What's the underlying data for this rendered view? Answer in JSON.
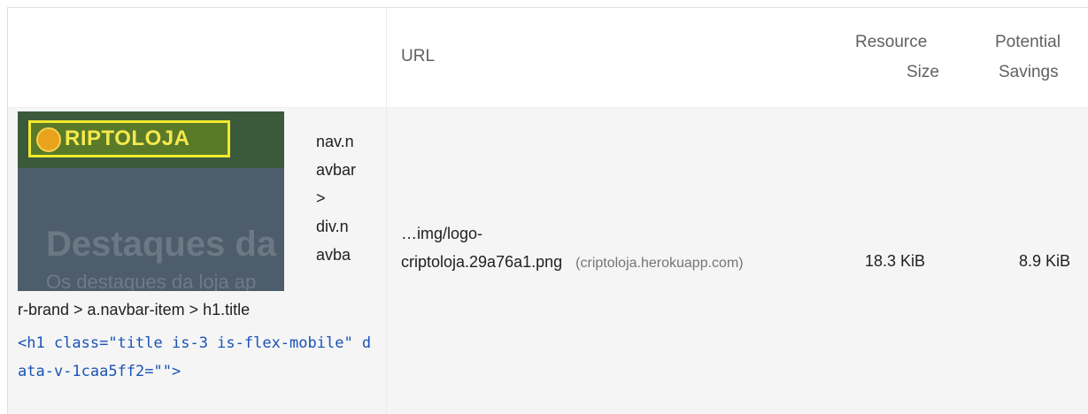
{
  "table": {
    "headers": {
      "url": "URL",
      "resource_size": [
        "Resource",
        "Size"
      ],
      "potential_savings": [
        "Potential",
        "Savings"
      ]
    },
    "rows": [
      {
        "thumbnail": {
          "logo_text": "RIPTOLOJA",
          "heading": "Destaques da l",
          "subheading": "Os destaques da loja ap"
        },
        "selector_wrapped": [
          "nav.n",
          "avbar",
          ">",
          "div.n",
          "avba"
        ],
        "selector_tail": "r-brand > a.navbar-item > h1.title",
        "snippet": "<h1 class=\"title is-3 is-flex-mobile\" data-v-1caa5ff2=\"\">",
        "url_path_line1": "…img/logo-",
        "url_path_line2": "criptoloja.29a76a1.png",
        "url_origin": "(criptoloja.herokuapp.com)",
        "resource_size": "18.3 KiB",
        "potential_savings": "8.9 KiB"
      }
    ]
  },
  "colors": {
    "row_background": "#f5f5f5",
    "code_text": "#1a53b5",
    "header_text": "#616161"
  }
}
